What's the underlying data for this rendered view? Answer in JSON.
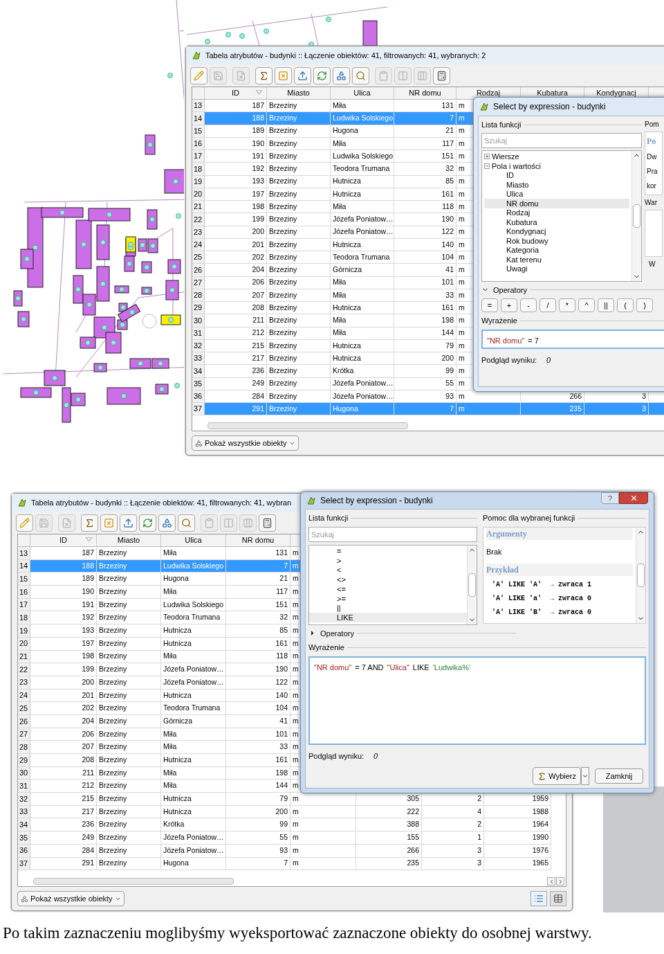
{
  "screenshot_1": {
    "attribute_table": {
      "title": "Tabela atrybutów - budynki :: Łączenie obiektów: 41, filtrowanych: 41, wybranych: 2",
      "toolbar": [
        {
          "kind": "edit",
          "disabled": false
        },
        {
          "kind": "save",
          "disabled": true
        },
        {
          "kind": "delete",
          "disabled": true
        },
        {
          "kind": "expression",
          "disabled": false
        },
        {
          "kind": "deselect",
          "disabled": false
        },
        {
          "kind": "move-top",
          "disabled": false
        },
        {
          "kind": "invert",
          "disabled": false
        },
        {
          "kind": "pan",
          "disabled": false
        },
        {
          "kind": "zoom",
          "disabled": false
        },
        {
          "kind": "copy",
          "disabled": true
        },
        {
          "kind": "new-column",
          "disabled": true
        },
        {
          "kind": "delete-column",
          "disabled": true
        },
        {
          "kind": "calculator",
          "disabled": false
        }
      ],
      "columns": [
        "ID",
        "Miasto",
        "Ulica",
        "NR domu",
        "Rodzaj",
        "Kubatura",
        "Kondygnacj"
      ],
      "rows": [
        {
          "num": "13",
          "selected": false,
          "cells": [
            "187",
            "Brzeziny",
            "Miła",
            "131",
            "m"
          ]
        },
        {
          "num": "14",
          "selected": true,
          "cells": [
            "188",
            "Brzeziny",
            "Ludwika Solskiego",
            "7",
            "m"
          ]
        },
        {
          "num": "15",
          "selected": false,
          "cells": [
            "189",
            "Brzeziny",
            "Hugona",
            "21",
            "m"
          ]
        },
        {
          "num": "16",
          "selected": false,
          "cells": [
            "190",
            "Brzeziny",
            "Miła",
            "117",
            "m"
          ]
        },
        {
          "num": "17",
          "selected": false,
          "cells": [
            "191",
            "Brzeziny",
            "Ludwika Solskiego",
            "151",
            "m"
          ]
        },
        {
          "num": "18",
          "selected": false,
          "cells": [
            "192",
            "Brzeziny",
            "Teodora Trumana",
            "32",
            "m"
          ]
        },
        {
          "num": "19",
          "selected": false,
          "cells": [
            "193",
            "Brzeziny",
            "Hutnicza",
            "85",
            "m"
          ]
        },
        {
          "num": "20",
          "selected": false,
          "cells": [
            "197",
            "Brzeziny",
            "Hutnicza",
            "161",
            "m"
          ]
        },
        {
          "num": "21",
          "selected": false,
          "cells": [
            "198",
            "Brzeziny",
            "Miła",
            "118",
            "m"
          ]
        },
        {
          "num": "22",
          "selected": false,
          "cells": [
            "199",
            "Brzeziny",
            "Józefa Poniatow…",
            "190",
            "m"
          ]
        },
        {
          "num": "23",
          "selected": false,
          "cells": [
            "200",
            "Brzeziny",
            "Józefa Poniatow…",
            "122",
            "m"
          ]
        },
        {
          "num": "24",
          "selected": false,
          "cells": [
            "201",
            "Brzeziny",
            "Hutnicza",
            "140",
            "m"
          ]
        },
        {
          "num": "25",
          "selected": false,
          "cells": [
            "202",
            "Brzeziny",
            "Teodora Trumana",
            "104",
            "m"
          ]
        },
        {
          "num": "26",
          "selected": false,
          "cells": [
            "204",
            "Brzeziny",
            "Górnicza",
            "41",
            "m"
          ]
        },
        {
          "num": "27",
          "selected": false,
          "cells": [
            "206",
            "Brzeziny",
            "Miła",
            "101",
            "m"
          ]
        },
        {
          "num": "28",
          "selected": false,
          "cells": [
            "207",
            "Brzeziny",
            "Miła",
            "33",
            "m"
          ]
        },
        {
          "num": "29",
          "selected": false,
          "cells": [
            "208",
            "Brzeziny",
            "Hutnicza",
            "161",
            "m"
          ]
        },
        {
          "num": "30",
          "selected": false,
          "cells": [
            "211",
            "Brzeziny",
            "Miła",
            "198",
            "m"
          ]
        },
        {
          "num": "31",
          "selected": false,
          "cells": [
            "212",
            "Brzeziny",
            "Miła",
            "144",
            "m"
          ]
        },
        {
          "num": "32",
          "selected": false,
          "cells": [
            "215",
            "Brzeziny",
            "Hutnicza",
            "79",
            "m"
          ]
        },
        {
          "num": "33",
          "selected": false,
          "cells": [
            "217",
            "Brzeziny",
            "Hutnicza",
            "200",
            "m"
          ]
        },
        {
          "num": "34",
          "selected": false,
          "cells": [
            "236",
            "Brzeziny",
            "Krótka",
            "99",
            "m"
          ]
        },
        {
          "num": "35",
          "selected": false,
          "cells": [
            "249",
            "Brzeziny",
            "Józefa Poniatow…",
            "55",
            "m"
          ]
        },
        {
          "num": "36",
          "selected": false,
          "cells": [
            "284",
            "Brzeziny",
            "Józefa Poniatow…",
            "93",
            "m",
            "266",
            "3"
          ]
        },
        {
          "num": "37",
          "selected": true,
          "cells": [
            "291",
            "Brzeziny",
            "Hugona",
            "7",
            "m",
            "235",
            "3"
          ]
        }
      ],
      "footer_button": "Pokaż wszystkie obiekty"
    },
    "dialog": {
      "title": "Select by expression - budynki",
      "functions_label": "Lista funkcji",
      "help_label": "Pom",
      "search": {
        "placeholder": "Szukaj"
      },
      "tree": [
        {
          "label": "Wiersze",
          "expanded": false
        },
        {
          "label": "Pola i wartości",
          "expanded": true,
          "children": [
            {
              "label": "ID",
              "selected": false
            },
            {
              "label": "Miasto",
              "selected": false
            },
            {
              "label": "Ulica",
              "selected": false
            },
            {
              "label": "NR domu",
              "selected": true
            },
            {
              "label": "Rodzaj",
              "selected": false
            },
            {
              "label": "Kubatura",
              "selected": false
            },
            {
              "label": "Kondygnacj",
              "selected": false
            },
            {
              "label": "Rok budowy",
              "selected": false
            },
            {
              "label": "Kategoria",
              "selected": false
            },
            {
              "label": "Kat terenu",
              "selected": false
            },
            {
              "label": "Uwagi",
              "selected": false
            }
          ]
        }
      ],
      "help": [
        {
          "kind": "heading",
          "text": "Po"
        },
        {
          "kind": "text",
          "text": "Dw"
        },
        {
          "kind": "text",
          "text": "Pra"
        },
        {
          "kind": "text",
          "text": "kor"
        }
      ],
      "values_label": "War",
      "values_footer": "W",
      "operators": {
        "label": "Operatory",
        "expanded": true,
        "buttons": [
          "=",
          "+",
          "-",
          "/",
          "*",
          "^",
          "||",
          "(",
          ")"
        ]
      },
      "expression_label": "Wyrażenie",
      "expression": [
        {
          "kind": "field",
          "text": "\"NR domu\""
        },
        {
          "kind": "plain",
          "text": "= 7"
        }
      ],
      "preview_label": "Podgląd wyniku:",
      "preview_value": "0"
    }
  },
  "screenshot_2": {
    "attribute_table": {
      "title": "Tabela atrybutów - budynki :: Łączenie obiektów: 41, filtrowanych: 41, wybran",
      "toolbar": [
        {
          "kind": "edit",
          "disabled": false
        },
        {
          "kind": "save",
          "disabled": true
        },
        {
          "kind": "delete",
          "disabled": true
        },
        {
          "kind": "expression",
          "disabled": false
        },
        {
          "kind": "deselect",
          "disabled": false
        },
        {
          "kind": "move-top",
          "disabled": false
        },
        {
          "kind": "invert",
          "disabled": false
        },
        {
          "kind": "pan",
          "disabled": false
        },
        {
          "kind": "zoom",
          "disabled": false
        },
        {
          "kind": "copy",
          "disabled": true
        },
        {
          "kind": "new-column",
          "disabled": true
        },
        {
          "kind": "delete-column",
          "disabled": true
        },
        {
          "kind": "calculator",
          "disabled": false
        }
      ],
      "columns": [
        "ID",
        "Miasto",
        "Ulica",
        "NR domu"
      ],
      "rows": [
        {
          "num": "13",
          "selected": false,
          "cells": [
            "187",
            "Brzeziny",
            "Miła",
            "131",
            "m"
          ]
        },
        {
          "num": "14",
          "selected": true,
          "cells": [
            "188",
            "Brzeziny",
            "Ludwika Solskiego",
            "7",
            "m"
          ]
        },
        {
          "num": "15",
          "selected": false,
          "cells": [
            "189",
            "Brzeziny",
            "Hugona",
            "21",
            "m"
          ]
        },
        {
          "num": "16",
          "selected": false,
          "cells": [
            "190",
            "Brzeziny",
            "Miła",
            "117",
            "m"
          ]
        },
        {
          "num": "17",
          "selected": false,
          "cells": [
            "191",
            "Brzeziny",
            "Ludwika Solskiego",
            "151",
            "m"
          ]
        },
        {
          "num": "18",
          "selected": false,
          "cells": [
            "192",
            "Brzeziny",
            "Teodora Trumana",
            "32",
            "m"
          ]
        },
        {
          "num": "19",
          "selected": false,
          "cells": [
            "193",
            "Brzeziny",
            "Hutnicza",
            "85",
            "m"
          ]
        },
        {
          "num": "20",
          "selected": false,
          "cells": [
            "197",
            "Brzeziny",
            "Hutnicza",
            "161",
            "m"
          ]
        },
        {
          "num": "21",
          "selected": false,
          "cells": [
            "198",
            "Brzeziny",
            "Miła",
            "118",
            "m"
          ]
        },
        {
          "num": "22",
          "selected": false,
          "cells": [
            "199",
            "Brzeziny",
            "Józefa Poniatow…",
            "190",
            "m"
          ]
        },
        {
          "num": "23",
          "selected": false,
          "cells": [
            "200",
            "Brzeziny",
            "Józefa Poniatow…",
            "122",
            "m"
          ]
        },
        {
          "num": "24",
          "selected": false,
          "cells": [
            "201",
            "Brzeziny",
            "Hutnicza",
            "140",
            "m"
          ]
        },
        {
          "num": "25",
          "selected": false,
          "cells": [
            "202",
            "Brzeziny",
            "Teodora Trumana",
            "104",
            "m"
          ]
        },
        {
          "num": "26",
          "selected": false,
          "cells": [
            "204",
            "Brzeziny",
            "Górnicza",
            "41",
            "m"
          ]
        },
        {
          "num": "27",
          "selected": false,
          "cells": [
            "206",
            "Brzeziny",
            "Miła",
            "101",
            "m"
          ]
        },
        {
          "num": "28",
          "selected": false,
          "cells": [
            "207",
            "Brzeziny",
            "Miła",
            "33",
            "m"
          ]
        },
        {
          "num": "29",
          "selected": false,
          "cells": [
            "208",
            "Brzeziny",
            "Hutnicza",
            "161",
            "m"
          ]
        },
        {
          "num": "30",
          "selected": false,
          "cells": [
            "211",
            "Brzeziny",
            "Miła",
            "198",
            "m"
          ]
        },
        {
          "num": "31",
          "selected": false,
          "cells": [
            "212",
            "Brzeziny",
            "Miła",
            "144",
            "m"
          ]
        },
        {
          "num": "32",
          "selected": false,
          "cells": [
            "215",
            "Brzeziny",
            "Hutnicza",
            "79",
            "m",
            "305",
            "2",
            "1959"
          ]
        },
        {
          "num": "33",
          "selected": false,
          "cells": [
            "217",
            "Brzeziny",
            "Hutnicza",
            "200",
            "m",
            "222",
            "4",
            "1988"
          ]
        },
        {
          "num": "34",
          "selected": false,
          "cells": [
            "236",
            "Brzeziny",
            "Krótka",
            "99",
            "m",
            "388",
            "2",
            "1964"
          ]
        },
        {
          "num": "35",
          "selected": false,
          "cells": [
            "249",
            "Brzeziny",
            "Józefa Poniatow…",
            "55",
            "m",
            "155",
            "1",
            "1990"
          ]
        },
        {
          "num": "36",
          "selected": false,
          "cells": [
            "284",
            "Brzeziny",
            "Józefa Poniatow…",
            "93",
            "m",
            "266",
            "3",
            "1976"
          ]
        },
        {
          "num": "37",
          "selected": false,
          "cells": [
            "291",
            "Brzeziny",
            "Hugona",
            "7",
            "m",
            "235",
            "3",
            "1965"
          ]
        }
      ],
      "footer_button": "Pokaż wszystkie obiekty"
    },
    "dialog": {
      "title": "Select by expression - budynki",
      "help_button": "?",
      "functions_label": "Lista funkcji",
      "help_label": "Pomoc dla wybranej funkcji",
      "search": {
        "placeholder": "Szukaj"
      },
      "items": [
        {
          "label": "=",
          "selected": false
        },
        {
          "label": ">",
          "selected": false
        },
        {
          "label": "<",
          "selected": false
        },
        {
          "label": "<>",
          "selected": false
        },
        {
          "label": "<=",
          "selected": false
        },
        {
          "label": ">=",
          "selected": false
        },
        {
          "label": "||",
          "selected": false
        },
        {
          "label": "LIKE",
          "selected": true
        }
      ],
      "help": [
        {
          "kind": "heading",
          "text": "Argumenty"
        },
        {
          "kind": "text",
          "text": "Brak"
        },
        {
          "kind": "heading",
          "text": "Przykład"
        },
        {
          "kind": "code",
          "text": "'A' LIKE 'A'  → zwraca 1"
        },
        {
          "kind": "code",
          "text": "'A' LIKE 'a'  → zwraca 0"
        },
        {
          "kind": "code",
          "text": "'A' LIKE 'B'  → zwraca 0"
        }
      ],
      "operators": {
        "label": "Operatory",
        "expanded": false
      },
      "expression_label": "Wyrażenie",
      "expression": [
        {
          "kind": "field",
          "text": "\"NR domu\""
        },
        {
          "kind": "plain",
          "text": "= 7 AND"
        },
        {
          "kind": "field",
          "text": "\"Ulica\""
        },
        {
          "kind": "plain",
          "text": "LIKE"
        },
        {
          "kind": "string",
          "text": "'Ludwika%'"
        }
      ],
      "preview_label": "Podgląd wyniku:",
      "preview_value": "0",
      "buttons": [
        "Wybierz",
        "Zamknij"
      ]
    }
  },
  "caption": "Po takim zaznaczeniu moglibyśmy wyeksportować zaznaczone obiekty do osobnej warstwy."
}
